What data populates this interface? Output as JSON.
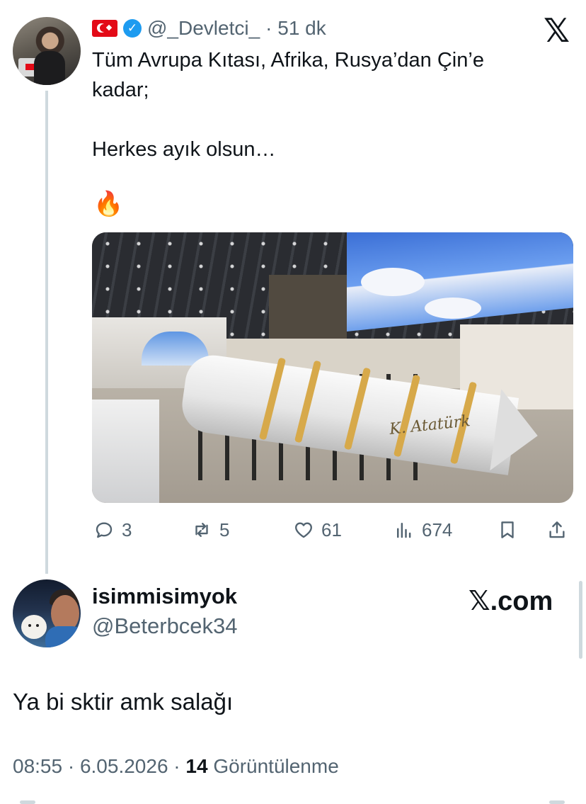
{
  "quoted_tweet": {
    "flag": "turkey-flag",
    "handle": "@_Devletci_",
    "time": "· 51 dk",
    "text": "Tüm Avrupa Kıtası, Afrika, Rusya’dan Çin’e\nkadar;\n\nHerkes ayık olsun…",
    "emoji": "🔥",
    "image_signature": "K. Atatürk",
    "stats": {
      "replies": "3",
      "reposts": "5",
      "likes": "61",
      "views": "674"
    }
  },
  "brand": {
    "x_glyph": "𝕏",
    "xcom_label": "𝕏.com"
  },
  "reply": {
    "name": "isimmisimyok",
    "handle": "@Beterbcek34",
    "text": "Ya bi sktir amk salağı"
  },
  "footer": {
    "time_date": "08:55 · 6.05.2026 · ",
    "views_count": "14",
    "views_label": " Görüntülenme"
  },
  "colors": {
    "text": "#0f1419",
    "secondary": "#536471",
    "verified": "#1d9bf0",
    "thread_line": "#cfd9de"
  }
}
